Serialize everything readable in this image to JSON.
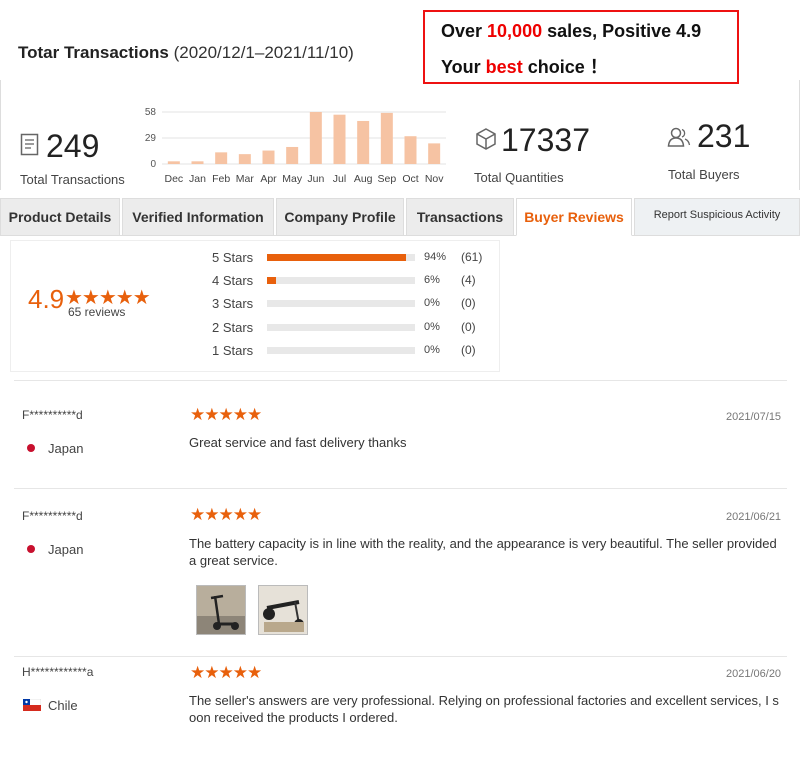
{
  "header": {
    "title_bold": "Totar Transactions",
    "title_range": "(2020/12/1–2021/11/10)"
  },
  "promo": {
    "line1_prefix": "Over ",
    "line1_highlight": "10,000",
    "line1_suffix": " sales, Positive 4.9",
    "line2_prefix": "Your ",
    "line2_highlight": "best",
    "line2_suffix": " choice ！"
  },
  "stats": {
    "transactions": {
      "value": "249",
      "label": "Total Transactions",
      "icon": "document-icon"
    },
    "quantities": {
      "value": "17337",
      "label": "Total Quantities",
      "icon": "box-icon"
    },
    "buyers": {
      "value": "231",
      "label": "Total Buyers",
      "icon": "users-icon"
    }
  },
  "chart_data": {
    "type": "bar",
    "categories": [
      "Dec",
      "Jan",
      "Feb",
      "Mar",
      "Apr",
      "May",
      "Jun",
      "Jul",
      "Aug",
      "Sep",
      "Oct",
      "Nov"
    ],
    "values": [
      3,
      3,
      13,
      11,
      15,
      19,
      58,
      55,
      48,
      57,
      31,
      23
    ],
    "yticks": [
      0,
      29,
      58
    ],
    "ylim": [
      0,
      58
    ],
    "bar_color": "#f6c3a3",
    "title": "",
    "xlabel": "",
    "ylabel": ""
  },
  "tabs": [
    {
      "label": "Product Details"
    },
    {
      "label": "Verified Information"
    },
    {
      "label": "Company Profile"
    },
    {
      "label": "Transactions"
    },
    {
      "label": "Buyer Reviews",
      "active": true
    },
    {
      "label": "Report Suspicious Activity"
    }
  ],
  "rating": {
    "score": "4.9",
    "stars": "★★★★★",
    "reviews_label": "65 reviews",
    "rows": [
      {
        "label": "5  Stars",
        "pct_text": "94%",
        "pct": 0.94,
        "count": "(61)"
      },
      {
        "label": "4  Stars",
        "pct_text": "6%",
        "pct": 0.06,
        "count": "(4)"
      },
      {
        "label": "3  Stars",
        "pct_text": "0%",
        "pct": 0,
        "count": "(0)"
      },
      {
        "label": "2  Stars",
        "pct_text": "0%",
        "pct": 0,
        "count": "(0)"
      },
      {
        "label": "1  Stars",
        "pct_text": "0%",
        "pct": 0,
        "count": "(0)"
      }
    ]
  },
  "reviews": [
    {
      "name": "F**********d",
      "country": "Japan",
      "stars": "★★★★★",
      "date": "2021/07/15",
      "text": "Great service and fast delivery thanks"
    },
    {
      "name": "F**********d",
      "country": "Japan",
      "stars": "★★★★★",
      "date": "2021/06/21",
      "text": "The battery capacity is in line with the reality, and the appearance is very beautiful. The seller provided a great service."
    },
    {
      "name": "H************a",
      "country": "Chile",
      "stars": "★★★★★",
      "date": "2021/06/20",
      "text": "The seller's answers are very professional. Relying on professional factories and excellent services, I s oon received the products I ordered."
    }
  ],
  "colors": {
    "accent": "#e8600c",
    "promo_border": "#ee1111",
    "bar": "#f6c3a3"
  }
}
